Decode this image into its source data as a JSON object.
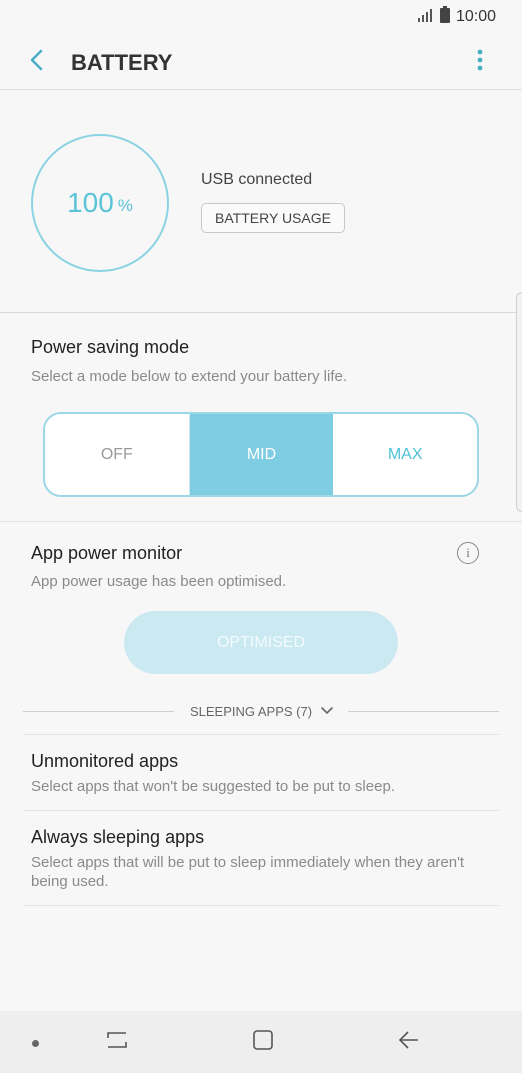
{
  "status_bar": {
    "time": "10:00",
    "icons": [
      "signal-icon",
      "battery-icon"
    ]
  },
  "app_bar": {
    "title": "BATTERY",
    "icons": [
      "back-arrow-icon",
      "more-vertical-icon"
    ]
  },
  "battery": {
    "level": "100",
    "unit": "%",
    "status": "USB connected",
    "usage_button": "BATTERY USAGE"
  },
  "power_saving": {
    "title": "Power saving mode",
    "subtitle": "Select a mode below to extend your battery life.",
    "modes": [
      "OFF",
      "MID",
      "MAX"
    ],
    "selected": "MID"
  },
  "app_power_monitor": {
    "title": "App power monitor",
    "subtitle": "App power usage has been optimised.",
    "button": "OPTIMISED",
    "icon": "info-icon"
  },
  "sleeping_apps": {
    "label": "SLEEPING APPS (7)"
  },
  "list": [
    {
      "title": "Unmonitored apps",
      "subtitle": "Select apps that won't be suggested to be put to sleep."
    },
    {
      "title": "Always sleeping apps",
      "subtitle": "Select apps that will be put to sleep immediately when they aren't being used."
    }
  ],
  "colors": {
    "accent": "#7ecde3",
    "accent_text": "#4ec0d6",
    "ring": "#8bd3e3"
  }
}
